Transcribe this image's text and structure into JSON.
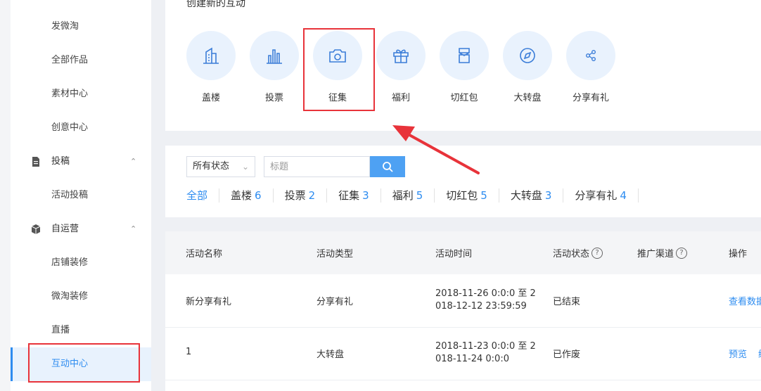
{
  "sidebar": {
    "items": [
      {
        "label": "发微淘"
      },
      {
        "label": "全部作品"
      },
      {
        "label": "素材中心"
      },
      {
        "label": "创意中心"
      },
      {
        "label": "投稿",
        "group": true,
        "icon": "document-icon"
      },
      {
        "label": "活动投稿"
      },
      {
        "label": "自运营",
        "group": true,
        "icon": "cube-icon"
      },
      {
        "label": "店铺装修"
      },
      {
        "label": "微淘装修"
      },
      {
        "label": "直播"
      },
      {
        "label": "互动中心",
        "active": true
      }
    ]
  },
  "create": {
    "title": "创建新的互动",
    "types": [
      {
        "label": "盖楼",
        "icon": "building-icon"
      },
      {
        "label": "投票",
        "icon": "bar-chart-icon"
      },
      {
        "label": "征集",
        "icon": "camera-icon"
      },
      {
        "label": "福利",
        "icon": "gift-icon"
      },
      {
        "label": "切红包",
        "icon": "red-packet-icon"
      },
      {
        "label": "大转盘",
        "icon": "compass-icon"
      },
      {
        "label": "分享有礼",
        "icon": "share-icon"
      }
    ]
  },
  "filters": {
    "status_select": "所有状态",
    "search_placeholder": "标题",
    "tabs": [
      {
        "label": "全部",
        "count": ""
      },
      {
        "label": "盖楼",
        "count": "6"
      },
      {
        "label": "投票",
        "count": "2"
      },
      {
        "label": "征集",
        "count": "3"
      },
      {
        "label": "福利",
        "count": "5"
      },
      {
        "label": "切红包",
        "count": "5"
      },
      {
        "label": "大转盘",
        "count": "3"
      },
      {
        "label": "分享有礼",
        "count": "4"
      }
    ]
  },
  "table": {
    "headers": {
      "name": "活动名称",
      "type": "活动类型",
      "time": "活动时间",
      "status": "活动状态",
      "channel": "推广渠道",
      "ops": "操作"
    },
    "rows": [
      {
        "name": "新分享有礼",
        "type": "分享有礼",
        "time_line1": "2018-11-26 0:0:0 至 2",
        "time_line2": "018-12-12 23:59:59",
        "status": "已结束",
        "op1": "查看数据",
        "op2": ""
      },
      {
        "name": "1",
        "type": "大转盘",
        "time_line1": "2018-11-23 0:0:0 至 2",
        "time_line2": "018-11-24 0:0:0",
        "status": "已作废",
        "op1": "预览",
        "op2": "编"
      }
    ]
  },
  "colors": {
    "accent": "#2d8cf0",
    "highlight": "#e8333a",
    "icon_bg": "#e9f2fd"
  }
}
